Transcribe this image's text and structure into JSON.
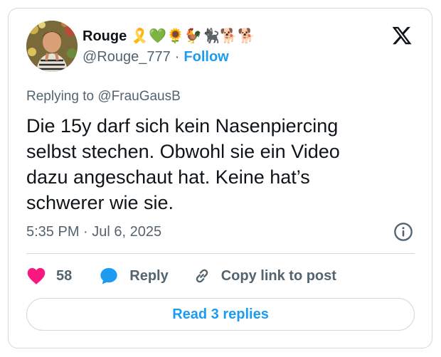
{
  "author": {
    "display_name": "Rouge",
    "emoji_icons": [
      "awareness-ribbon-icon",
      "green-heart-icon",
      "sunflower-icon",
      "rooster-icon",
      "black-cat-icon",
      "dog-icon",
      "dog-icon"
    ],
    "emoji_glyphs": [
      "🎗️",
      "💚",
      "🌻",
      "🐓",
      "🐈‍⬛",
      "🐕",
      "🐕"
    ],
    "handle": "@Rouge_777",
    "separator": "·",
    "follow_label": "Follow"
  },
  "reply_context": {
    "prefix": "Replying to ",
    "mention": "@FrauGausB"
  },
  "tweet": {
    "text": "Die 15y darf sich kein Nasenpiercing\nselbst stechen. Obwohl sie ein Video\ndazu angeschaut hat. Keine hat’s\nschwerer wie sie.",
    "timestamp": "5:35 PM · Jul 6, 2025"
  },
  "actions": {
    "like_count": "58",
    "reply_label": "Reply",
    "copy_link_label": "Copy link to post"
  },
  "read_replies_label": "Read 3 replies",
  "colors": {
    "accent": "#1d9bf0",
    "like": "#f91880",
    "text_primary": "#0f1419",
    "text_secondary": "#536471",
    "border": "#cfd9de"
  }
}
